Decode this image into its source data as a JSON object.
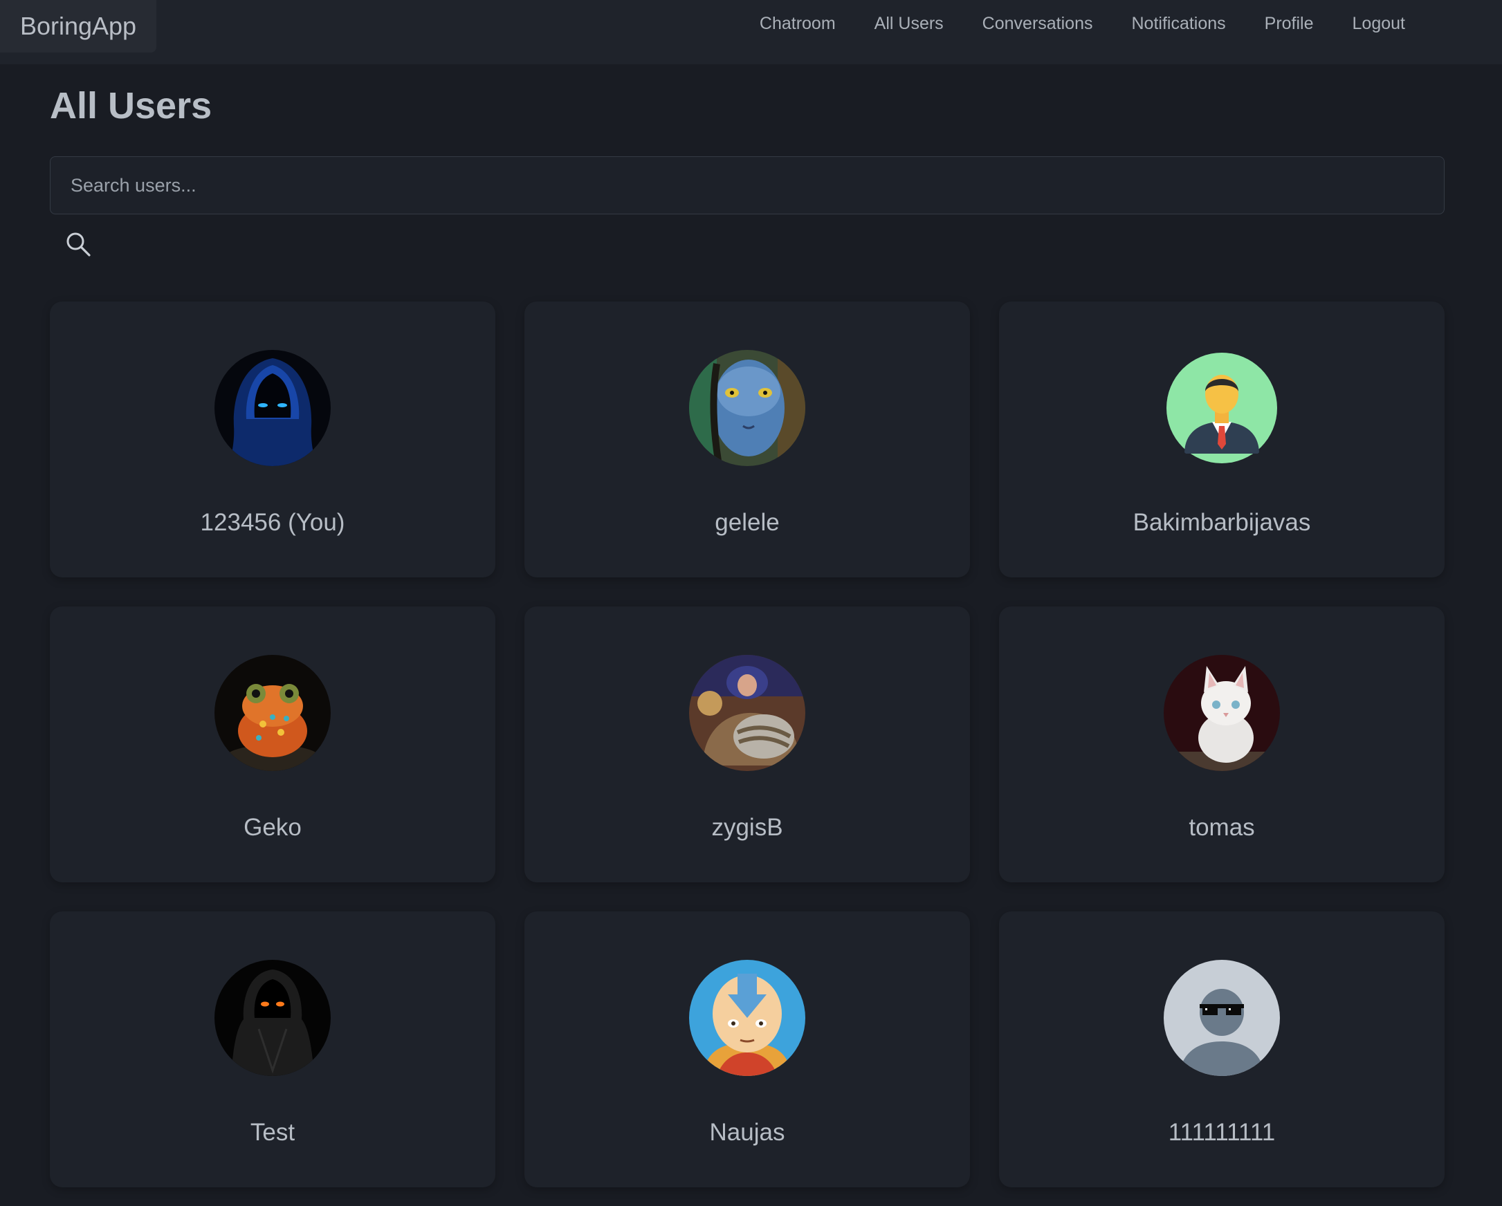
{
  "app": {
    "brand": "BoringApp"
  },
  "nav": {
    "links": [
      "Chatroom",
      "All Users",
      "Conversations",
      "Notifications",
      "Profile",
      "Logout"
    ]
  },
  "page": {
    "title": "All Users"
  },
  "search": {
    "placeholder": "Search users...",
    "value": ""
  },
  "users": [
    {
      "name": "123456 (You)",
      "avatar": "blue-hooded-figure-avatar"
    },
    {
      "name": "gelele",
      "avatar": "blue-alien-face-avatar"
    },
    {
      "name": "Bakimbarbijavas",
      "avatar": "businessman-avatar"
    },
    {
      "name": "Geko",
      "avatar": "orange-frog-avatar"
    },
    {
      "name": "zygisB",
      "avatar": "armored-warrior-avatar"
    },
    {
      "name": "tomas",
      "avatar": "white-kitten-avatar"
    },
    {
      "name": "Test",
      "avatar": "dark-hooded-figure-avatar"
    },
    {
      "name": "Naujas",
      "avatar": "cartoon-monk-avatar"
    },
    {
      "name": "111111111",
      "avatar": "default-user-sunglasses-avatar"
    }
  ]
}
